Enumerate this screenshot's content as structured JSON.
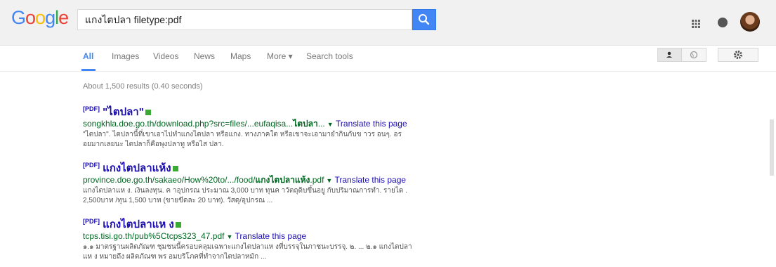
{
  "header": {
    "logo": "Google",
    "logo_colors": [
      "#4285f4",
      "#ea4335",
      "#fbbc05",
      "#4285f4",
      "#34a853",
      "#ea4335"
    ],
    "query": "แกงไตปลา filetype:pdf"
  },
  "tabs": [
    {
      "label": "All"
    },
    {
      "label": "Images"
    },
    {
      "label": "Videos"
    },
    {
      "label": "News"
    },
    {
      "label": "Maps"
    },
    {
      "label": "More ▾"
    },
    {
      "label": "Search tools"
    }
  ],
  "stats": "About 1,500 results (0.40 seconds)",
  "results": [
    {
      "tag": "[PDF]",
      "title": "\"ไตปลา\"",
      "url": "songkhla.doe.go.th/download.php?src=files/...eufaqisa...",
      "url_bold": "ไตปลา",
      "url_suffix": "...",
      "translate": "Translate this page",
      "snippet1": "\"ไตปลา\". ไตปลานี้ที่เขาเอาไปทำแกงไตปลา หรือแกง. ทางภาคใต หรือเขาจะเอามายำกินกับข าวร อนๆ. อร",
      "snippet2": "อยมากเลยนะ ไตปลาก็คือพุงปลาทู หรือไส ปลา."
    },
    {
      "tag": "[PDF]",
      "title": "แกงไตปลาแห้ง",
      "url": "province.doe.go.th/sakaeo/How%20to/.../food/",
      "url_bold": "แกงไตปลาแห้ง",
      "url_suffix": ".pdf",
      "translate": "Translate this page",
      "snippet1": "แกงไตปลาแห ง. เงินลงทุน. ค าอุปกรณ ประมาณ 3,000 บาท ทุนค าวัตถุดิบขึ้นอยู กับปริมาณการทำ. รายได .",
      "snippet2": "2,500บาท /ทุน 1,500 บาท (ขายขีดละ 20 บาท). วัสดุ/อุปกรณ ..."
    },
    {
      "tag": "[PDF]",
      "title": "แกงไตปลาแห ง",
      "url": "tcps.tisi.go.th/pub%5Ctcps323_47.pdf",
      "url_bold": "",
      "url_suffix": "",
      "translate": "Translate this page",
      "snippet1": "๑.๑ มาตรฐานผลิตภัณฑ ชุมชนนี้ครอบคลุมเฉพาะแกงไตปลาแห งที่บรรจุในภาชนะบรรจุ. ๒. ... ๒.๑ แกงไตปลา",
      "snippet2": "แห ง หมายถึง ผลิตภัณฑ พร อมบริโภคที่ทำจากไตปลาหมัก ..."
    }
  ]
}
